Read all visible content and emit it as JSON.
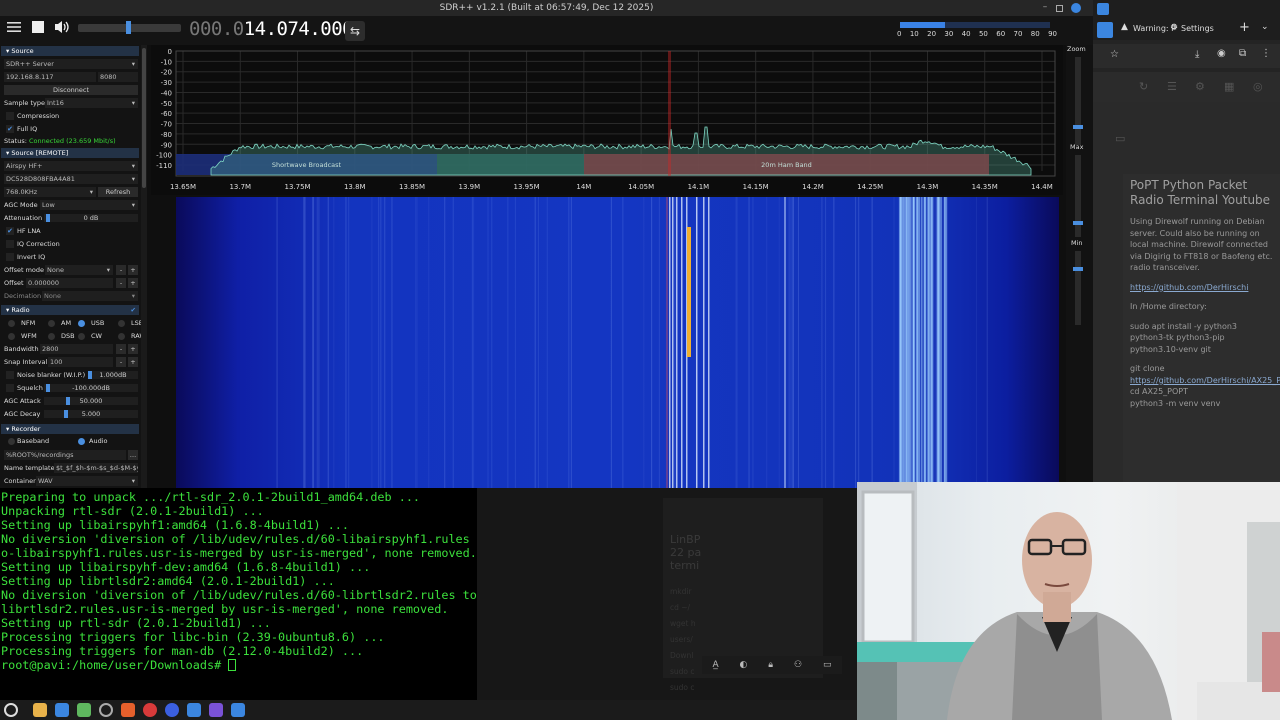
{
  "sdr": {
    "window_title": "SDR++ v1.2.1 (Built at 06:57:49, Dec 12 2025)",
    "frequency_dim": "000.0",
    "frequency_main": "14.074.000",
    "snr_scale": [
      "0",
      "10",
      "20",
      "30",
      "40",
      "50",
      "60",
      "70",
      "80",
      "90"
    ],
    "snr_level": 0.3,
    "menu": {
      "source_header": "Source",
      "source_type": "SDR++ Server",
      "host": "192.168.8.117",
      "port": "8080",
      "disconnect": "Disconnect",
      "sample_type_label": "Sample type",
      "sample_type": "Int16",
      "compression": "Compression",
      "full_iq": "Full IQ",
      "status_label": "Status:",
      "status_value": "Connected (23.659 Mbit/s)",
      "source_remote_header": "Source [REMOTE]",
      "device": "Airspy HF+",
      "serial": "DC528D808FBA4A81",
      "samplerate": "768.0KHz",
      "refresh": "Refresh",
      "agc_mode_label": "AGC Mode",
      "agc_mode": "Low",
      "attenuation_label": "Attenuation",
      "attenuation": "0 dB",
      "hf_lna": "HF LNA",
      "iq_correction": "IQ Correction",
      "invert_iq": "Invert IQ",
      "offset_mode_label": "Offset mode",
      "offset_mode": "None",
      "offset_label": "Offset",
      "offset": "0.000000",
      "decimation_label": "Decimation",
      "decimation": "None",
      "radio_header": "Radio",
      "modes": [
        "NFM",
        "AM",
        "USB",
        "LSB",
        "WFM",
        "DSB",
        "CW",
        "RAW"
      ],
      "bandwidth_label": "Bandwidth",
      "bandwidth": "2800",
      "snap_label": "Snap Interval",
      "snap": "100",
      "noise_blanker_label": "Noise blanker (W.I.P.)",
      "noise_blanker": "1.000dB",
      "squelch_label": "Squelch",
      "squelch": "-100.000dB",
      "agc_attack_label": "AGC Attack",
      "agc_attack": "50.000",
      "agc_decay_label": "AGC Decay",
      "agc_decay": "5.000",
      "recorder_header": "Recorder",
      "baseband": "Baseband",
      "audio": "Audio",
      "rec_path": "%ROOT%/recordings",
      "name_template_label": "Name template",
      "name_template": "$t_$f_$h-$m-$s_$d-$M-$y",
      "container_label": "Container",
      "container": "WAV"
    },
    "fft": {
      "y_ticks": [
        "0",
        "-10",
        "-20",
        "-30",
        "-40",
        "-50",
        "-60",
        "-70",
        "-80",
        "-90",
        "-100",
        "-110"
      ],
      "x_ticks": [
        "13.65M",
        "13.7M",
        "13.75M",
        "13.8M",
        "13.85M",
        "13.9M",
        "13.95M",
        "14M",
        "14.05M",
        "14.1M",
        "14.15M",
        "14.2M",
        "14.25M",
        "14.3M",
        "14.35M",
        "14.4M"
      ],
      "bands": [
        {
          "label": "Shortwave Broadcast",
          "color": "#1c2e7a"
        },
        {
          "label": "",
          "color": "#1d4d48"
        },
        {
          "label": "20m Ham Band",
          "color": "#8a1a28"
        }
      ]
    },
    "right_panel": {
      "zoom": "Zoom",
      "max": "Max",
      "min": "Min"
    }
  },
  "browser": {
    "tab_warning": "Warning: P",
    "tab_settings": "Settings",
    "page_title": "PoPT Python Packet Radio Terminal Youtube",
    "p1": "Using Direwolf running on Debian server. Could also be running on local machine. Direwolf connected via Digirig to FT818 or Baofeng etc. radio transceiver.",
    "link1": "https://github.com/DerHirschi",
    "p2": "In /Home directory:",
    "p3": "sudo apt install -y python3 python3-tk python3-pip python3.10-venv git",
    "p4_a": "git clone ",
    "link2": "https://github.com/DerHirschi/AX25_PoPT.git",
    "p5": "cd AX25_POPT",
    "p6": "python3 -m venv venv"
  },
  "terminal": {
    "lines": [
      "Preparing to unpack .../rtl-sdr_2.0.1-2build1_amd64.deb ...",
      "Unpacking rtl-sdr (2.0.1-2build1) ...",
      "Setting up libairspyhf1:amd64 (1.6.8-4build1) ...",
      "No diversion 'diversion of /lib/udev/rules.d/60-libairspyhf1.rules t",
      "o-libairspyhf1.rules.usr-is-merged by usr-is-merged', none removed.",
      "Setting up libairspyhf-dev:amd64 (1.6.8-4build1) ...",
      "Setting up librtlsdr2:amd64 (2.0.1-2build1) ...",
      "No diversion 'diversion of /lib/udev/rules.d/60-librtlsdr2.rules to",
      "librtlsdr2.rules.usr-is-merged by usr-is-merged', none removed.",
      "Setting up rtl-sdr (2.0.1-2build1) ...",
      "Processing triggers for libc-bin (2.39-0ubuntu8.6) ...",
      "Processing triggers for man-db (2.12.0-4build2) ...",
      "root@pavi:/home/user/Downloads# "
    ]
  },
  "background_window": {
    "ghost_title": "LinBP\n22 pa\ntermi",
    "ghost_lines": [
      "mkdir",
      "cd ~/",
      "wget h",
      "users/",
      "Downl",
      "sudo c",
      "sudo c",
      "\"CAP_NET_ADMIN+ep"
    ]
  },
  "colors": {
    "terminal_green": "#3ce03c",
    "accent": "#4a8fe0",
    "spectrum": "#7fd7c4",
    "band_ham": "#8a1a28",
    "band_sw": "#1c2e7a"
  }
}
